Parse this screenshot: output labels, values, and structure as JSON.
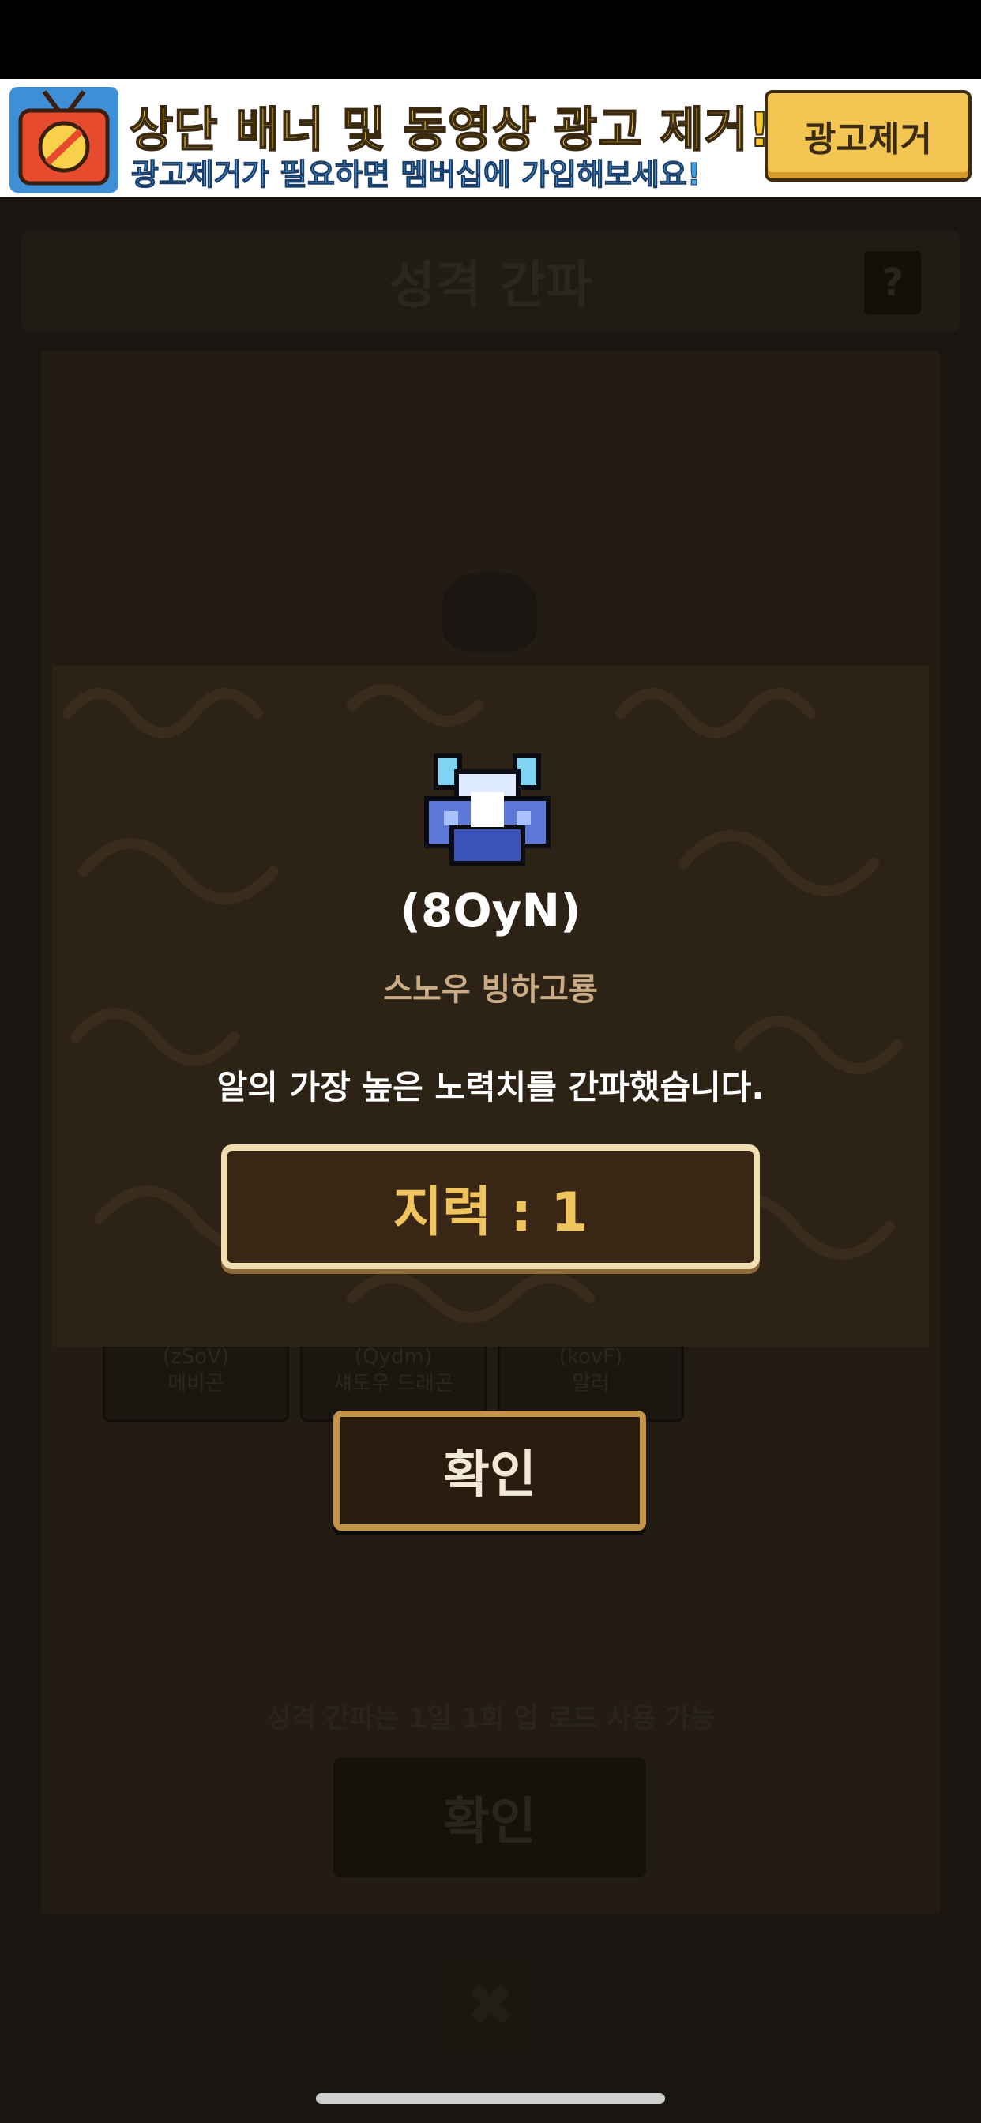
{
  "ad_banner": {
    "title": "상단 배너 및 동영상 광고 제거!",
    "subtitle": "광고제거가 필요하면 멤버십에 가입해보세요!",
    "remove_button_label": "광고제거",
    "icon": "no-ads-tv-icon"
  },
  "background_screen": {
    "title": "성격 간파",
    "help_label": "?",
    "cards": [
      {
        "code": "(zSoV)",
        "name": "메비곤"
      },
      {
        "code": "(Qydm)",
        "name": "섀도우 드래곤"
      },
      {
        "code": "(kovF)",
        "name": "말러"
      }
    ],
    "note": "성격 간파는 1일 1회 업 로드 사용 가능",
    "confirm_label": "확인",
    "close_label": "✖"
  },
  "popup": {
    "egg_icon": "snow-glacier-dragon-egg-icon",
    "egg_code": "(8OyN)",
    "egg_name": "스노우 빙하고룡",
    "message": "알의 가장 높은 노력치를 간파했습니다.",
    "stat_text": "지력 : 1"
  },
  "confirm_button_label": "확인",
  "colors": {
    "popup_bg": "#2d2216",
    "stat_text": "#f0c45c",
    "egg_name": "#c9ab86",
    "banner_title": "#f6c832"
  }
}
